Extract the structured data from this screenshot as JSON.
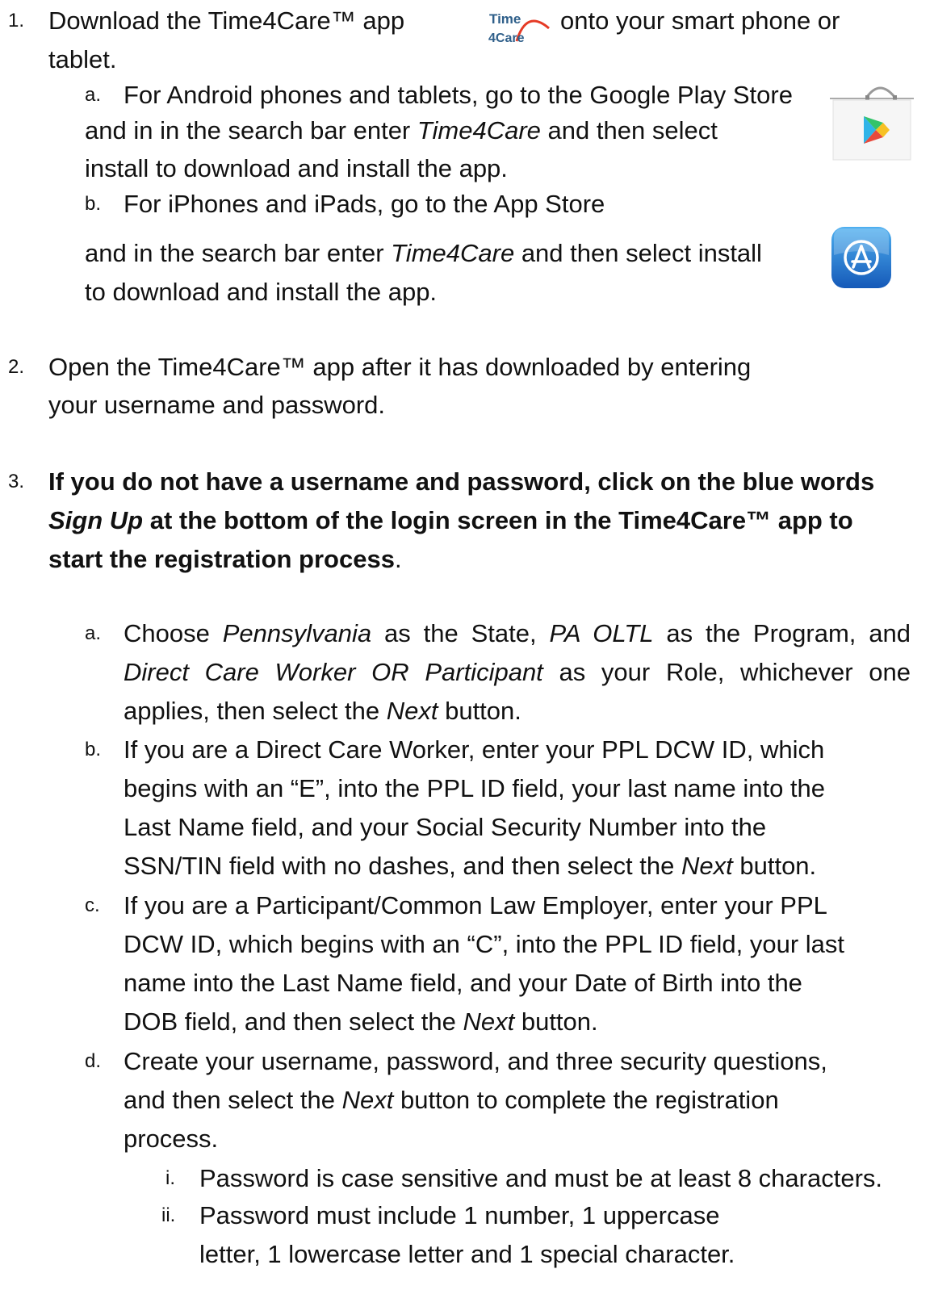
{
  "items": [
    {
      "marker": "1.",
      "lines": [
        "Download the Time4Care™ app",
        "onto your smart phone or",
        "tablet."
      ],
      "app_icon": {
        "top": "Time",
        "bottom": "4Care",
        "icon": "time4care-logo"
      },
      "subs": [
        {
          "marker": "a.",
          "lines": [
            "For Android phones and tablets, go to the Google Play Store",
            [
              "and in in the search bar enter ",
              "Time4Care",
              " and then select"
            ],
            "install to  download and install the app."
          ],
          "icon": "google-play-store-icon"
        },
        {
          "marker": "b.",
          "lines": [
            "For iPhones and iPads, go to the App Store",
            [
              "and in the search bar enter ",
              "Time4Care",
              " and then select install"
            ],
            "to  download and install the app."
          ],
          "icon": "app-store-icon"
        }
      ]
    },
    {
      "marker": "2.",
      "lines": [
        "Open the Time4Care™ app after it has downloaded by entering",
        "your  username and  password."
      ]
    },
    {
      "marker": "3.",
      "lines": [
        "If you do not have a username and password, click on the blue words",
        [
          "Sign Up",
          " at the  bottom of the login screen in the Time4Care™ app to"
        ],
        [
          "start  the registration process",
          "."
        ]
      ],
      "subs": [
        {
          "marker": "a.",
          "lines": [
            [
              "Choose ",
              "Pennsylvania",
              " as the State, ",
              "PA OLTL",
              " as the Program, and"
            ],
            [
              "Direct  Care  Worker OR Participant",
              " as your Role, whichever one"
            ],
            [
              "applies, then  select the ",
              "Next",
              "  button."
            ]
          ]
        },
        {
          "marker": "b.",
          "lines": [
            "If you are a Direct Care Worker, enter your PPL DCW ID, which",
            "begins  with an  “E”, into the PPL ID field, your last name into the",
            "Last Name  field, and your Social  Security Number into the",
            [
              "SSN/TIN field with no  dashes, and then select the ",
              "Next",
              "  button."
            ]
          ]
        },
        {
          "marker": "c.",
          "lines": [
            "If you are a Participant/Common Law Employer, enter your PPL",
            "DCW  ID, which  begins with an “C”, into the PPL ID field, your last",
            "name  into the Last Name field,  and your Date of Birth into the",
            [
              "DOB field,  and then select the ",
              "Next",
              " button."
            ]
          ]
        },
        {
          "marker": "d.",
          "lines": [
            "Create your username, password, and three security questions,",
            [
              "and  then select  the ",
              "Next",
              " button to complete the registration"
            ],
            "process."
          ],
          "subs": [
            {
              "marker": "i.",
              "lines": [
                "Password is case sensitive and must be at least 8 characters."
              ]
            },
            {
              "marker": "ii.",
              "lines": [
                "Password must include 1 number, 1 uppercase",
                "letter, 1  lowercase letter  and 1 special character."
              ]
            }
          ]
        }
      ]
    }
  ]
}
